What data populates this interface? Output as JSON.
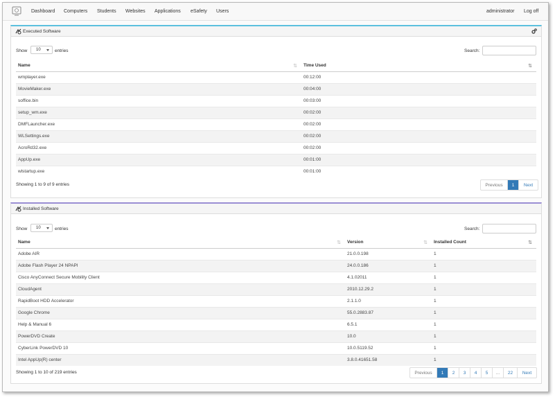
{
  "nav": {
    "items": [
      "Dashboard",
      "Computers",
      "Students",
      "Websites",
      "Applications",
      "eSafety",
      "Users"
    ],
    "user": "administrator",
    "logoff": "Log off"
  },
  "executed": {
    "title": "Executed Software",
    "show_label": "Show",
    "entries_value": "10",
    "entries_label": "entries",
    "search_label": "Search:",
    "columns": [
      "Name",
      "Time Used"
    ],
    "rows": [
      [
        "wmplayer.exe",
        "00:12:00"
      ],
      [
        "MovieMaker.exe",
        "00:04:00"
      ],
      [
        "soffice.bin",
        "00:03:00"
      ],
      [
        "setup_wm.exe",
        "00:02:00"
      ],
      [
        "DMFLauncher.exe",
        "00:02:00"
      ],
      [
        "WLSettings.exe",
        "00:02:00"
      ],
      [
        "AcroRd32.exe",
        "00:02:00"
      ],
      [
        "AppUp.exe",
        "00:01:00"
      ],
      [
        "wlstartup.exe",
        "00:01:00"
      ]
    ],
    "info": "Showing 1 to 9 of 9 entries",
    "pager": {
      "previous": "Previous",
      "pages": [
        "1"
      ],
      "next": "Next"
    }
  },
  "installed": {
    "title": "Installed Software",
    "show_label": "Show",
    "entries_value": "10",
    "entries_label": "entries",
    "search_label": "Search:",
    "columns": [
      "Name",
      "Version",
      "Installed Count"
    ],
    "rows": [
      [
        "Adobe AIR",
        "21.0.0.198",
        "1"
      ],
      [
        "Adobe Flash Player 24 NPAPI",
        "24.0.0.186",
        "1"
      ],
      [
        "Cisco AnyConnect Secure Mobility Client",
        "4.1.02011",
        "1"
      ],
      [
        "CloudAgent",
        "2010.12.29.2",
        "1"
      ],
      [
        "RapidBoot HDD Accelerator",
        "2.1.1.0",
        "1"
      ],
      [
        "Google Chrome",
        "55.0.2883.87",
        "1"
      ],
      [
        "Help & Manual 6",
        "6.5.1",
        "1"
      ],
      [
        "PowerDVD Create",
        "10.0",
        "1"
      ],
      [
        "CyberLink PowerDVD 10",
        "10.0.5119.52",
        "1"
      ],
      [
        "Intel AppUp(R) center",
        "3.8.0.41651.58",
        "1"
      ]
    ],
    "info": "Showing 1 to 10 of 219 entries",
    "pager": {
      "previous": "Previous",
      "pages": [
        "1",
        "2",
        "3",
        "4",
        "5",
        "...",
        "22"
      ],
      "next": "Next"
    }
  }
}
